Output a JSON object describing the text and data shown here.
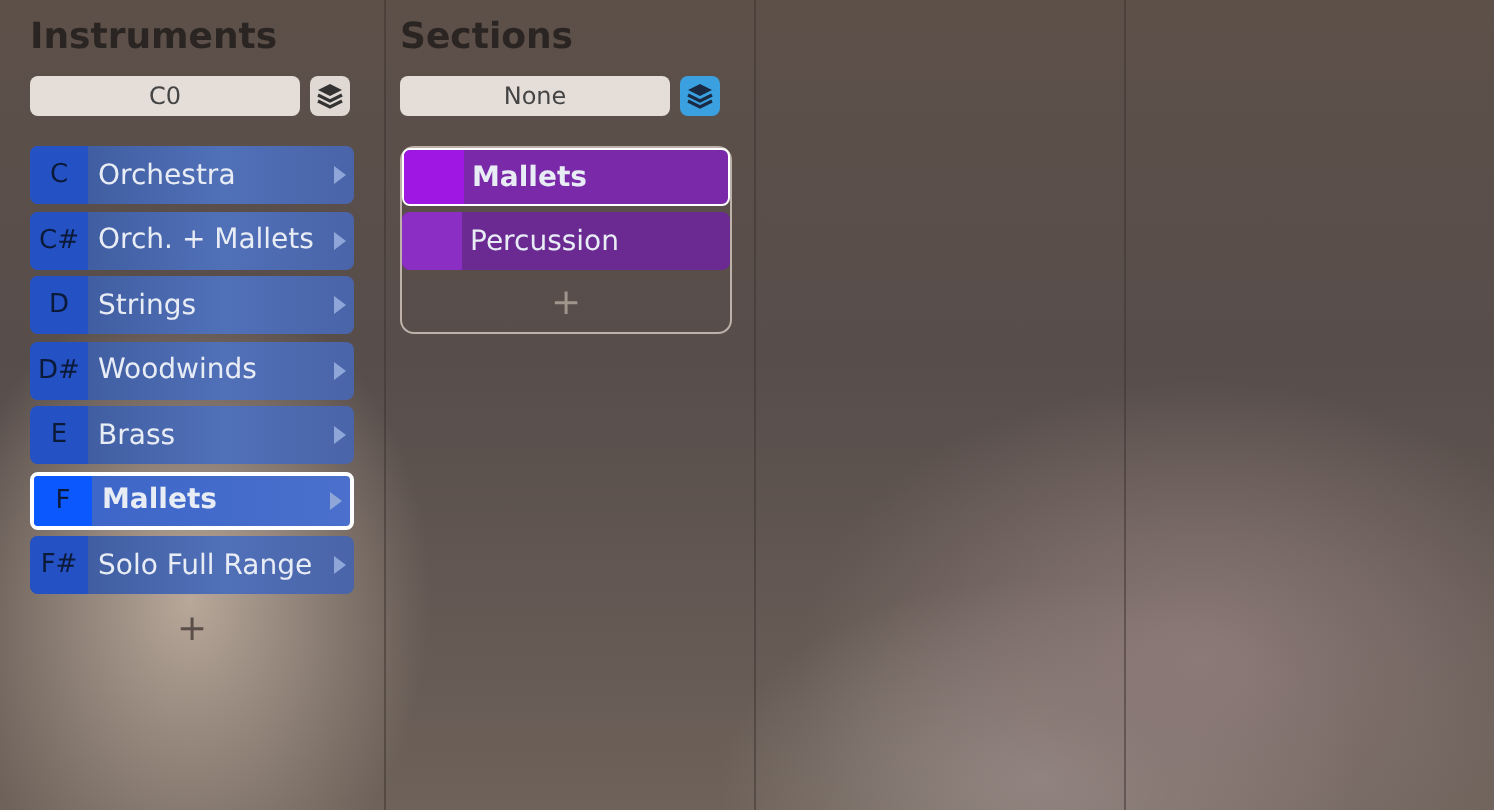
{
  "columns": [
    {
      "title": "Instruments",
      "selector": {
        "value": "C0"
      },
      "layer_button": {
        "on": false
      },
      "kind": "keyed",
      "items": [
        {
          "key": "C",
          "label": "Orchestra",
          "selected": false
        },
        {
          "key": "C#",
          "label": "Orch. + Mallets",
          "selected": false
        },
        {
          "key": "D",
          "label": "Strings",
          "selected": false
        },
        {
          "key": "D#",
          "label": "Woodwinds",
          "selected": false
        },
        {
          "key": "E",
          "label": "Brass",
          "selected": false
        },
        {
          "key": "F",
          "label": "Mallets",
          "selected": true
        },
        {
          "key": "F#",
          "label": "Solo Full Range",
          "selected": false
        }
      ],
      "add_button": "+"
    },
    {
      "title": "Sections",
      "selector": {
        "value": "None"
      },
      "layer_button": {
        "on": true
      },
      "kind": "colored",
      "items": [
        {
          "label": "Mallets",
          "selected": true,
          "color": "#9e17e3"
        },
        {
          "label": "Percussion",
          "selected": false,
          "color": "#8a2ec4"
        }
      ],
      "add_button": "+"
    }
  ]
}
